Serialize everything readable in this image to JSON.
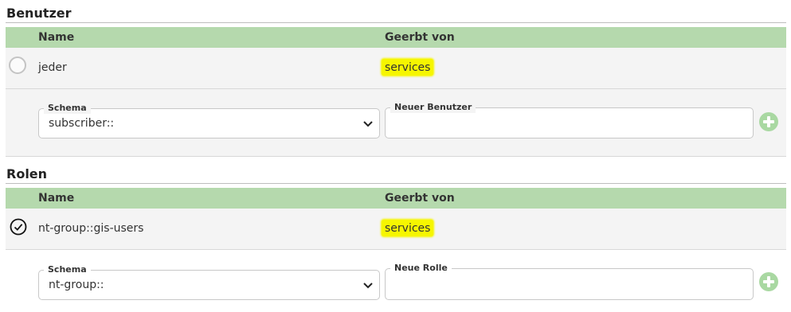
{
  "users_section": {
    "title": "Benutzer",
    "headers": {
      "name": "Name",
      "inherited_from": "Geerbt von"
    },
    "rows": [
      {
        "name": "jeder",
        "inherited_from": "services",
        "selected": false
      }
    ],
    "form": {
      "schema_label": "Schema",
      "schema_value": "subscriber::",
      "new_label": "Neuer Benutzer",
      "new_value": ""
    }
  },
  "roles_section": {
    "title": "Rolen",
    "headers": {
      "name": "Name",
      "inherited_from": "Geerbt von"
    },
    "rows": [
      {
        "name": "nt-group::gis-users",
        "inherited_from": "services",
        "selected": true
      }
    ],
    "form": {
      "schema_label": "Schema",
      "schema_value": "nt-group::",
      "new_label": "Neue Rolle",
      "new_value": ""
    }
  },
  "colors": {
    "header_bg": "#b5d9ad",
    "row_bg": "#f4f4f4",
    "highlight": "#f6f600",
    "add_button": "#a9d8a2"
  },
  "icons": {
    "radio_unselected": "circle-outline-icon",
    "radio_selected": "check-circle-icon",
    "add": "plus-circle-icon",
    "dropdown": "chevron-down-icon"
  }
}
